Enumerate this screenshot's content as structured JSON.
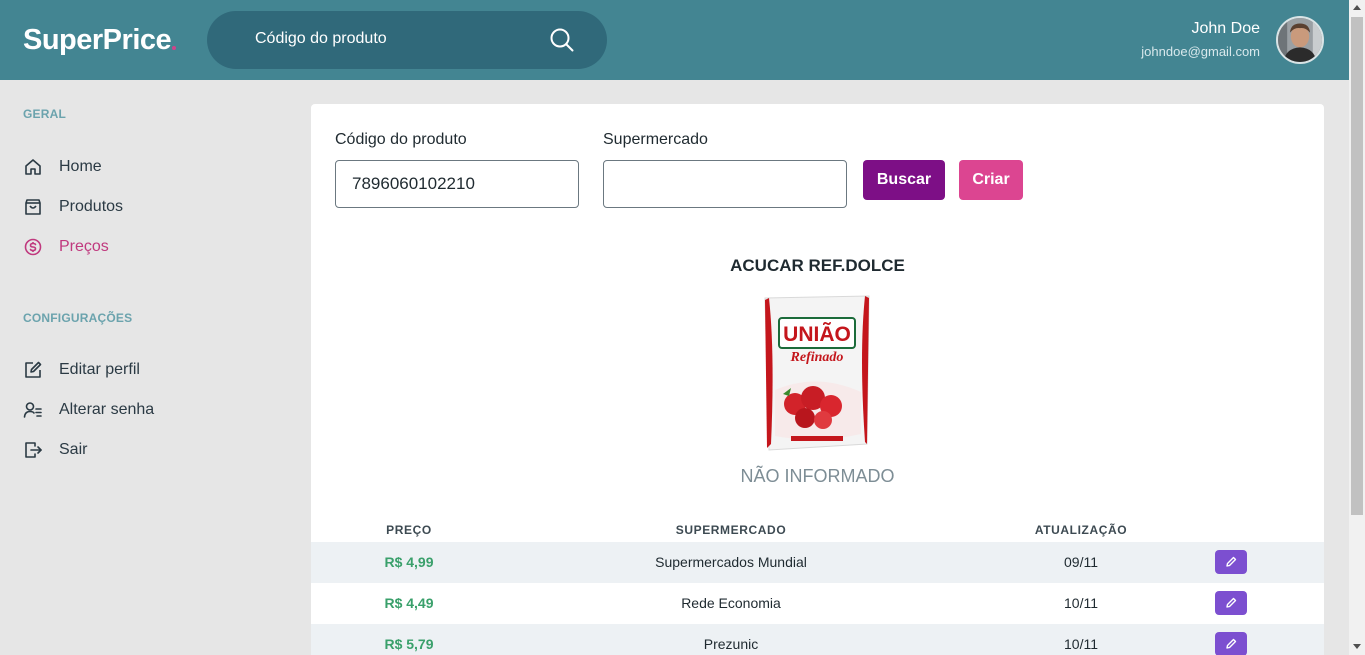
{
  "header": {
    "logo": "SuperPrice",
    "search_placeholder": "Código do produto",
    "user_name": "John Doe",
    "user_email": "johndoe@gmail.com"
  },
  "sidebar": {
    "section_general": "GERAL",
    "items_general": [
      {
        "label": "Home",
        "icon": "home-icon"
      },
      {
        "label": "Produtos",
        "icon": "bag-icon"
      },
      {
        "label": "Preços",
        "icon": "dollar-circle-icon",
        "active": true
      }
    ],
    "section_config": "CONFIGURAÇÕES",
    "items_config": [
      {
        "label": "Editar perfil",
        "icon": "edit-icon"
      },
      {
        "label": "Alterar senha",
        "icon": "user-list-icon"
      },
      {
        "label": "Sair",
        "icon": "logout-icon"
      }
    ]
  },
  "form": {
    "code_label": "Código do produto",
    "code_value": "7896060102210",
    "market_label": "Supermercado",
    "market_value": "",
    "search_button": "Buscar",
    "create_button": "Criar"
  },
  "product": {
    "name": "ACUCAR REF.DOLCE",
    "brand_text": "UNIÃO",
    "variant_text": "Refinado",
    "status": "NÃO INFORMADO"
  },
  "table": {
    "columns": [
      "PREÇO",
      "SUPERMERCADO",
      "ATUALIZAÇÃO"
    ],
    "rows": [
      {
        "price": "R$ 4,99",
        "market": "Supermercados Mundial",
        "date": "09/11"
      },
      {
        "price": "R$ 4,49",
        "market": "Rede Economia",
        "date": "10/11"
      },
      {
        "price": "R$ 5,79",
        "market": "Prezunic",
        "date": "10/11"
      }
    ]
  },
  "colors": {
    "header_bg": "#438592",
    "search_bg": "#30697a",
    "accent_pink": "#dc4591",
    "accent_purple": "#7d0f86",
    "edit_button": "#7c4fd0",
    "price_green": "#3aa06b"
  }
}
